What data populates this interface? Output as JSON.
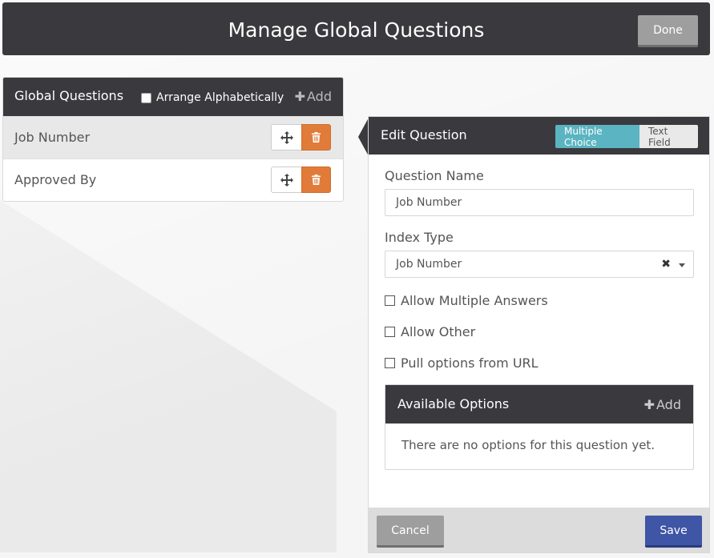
{
  "header": {
    "title": "Manage Global Questions",
    "done_label": "Done"
  },
  "global_questions": {
    "title": "Global Questions",
    "arrange_label": "Arrange Alphabetically",
    "arrange_checked": false,
    "add_label": "Add",
    "items": [
      {
        "label": "Job Number",
        "selected": true
      },
      {
        "label": "Approved By",
        "selected": false
      }
    ]
  },
  "edit_question": {
    "title": "Edit Question",
    "type_options": [
      "Multiple Choice",
      "Text Field"
    ],
    "type_selected": "Multiple Choice",
    "question_name_label": "Question Name",
    "question_name_value": "Job Number",
    "index_type_label": "Index Type",
    "index_type_value": "Job Number",
    "checkboxes": [
      {
        "label": "Allow Multiple Answers",
        "checked": false
      },
      {
        "label": "Allow Other",
        "checked": false
      },
      {
        "label": "Pull options from URL",
        "checked": false
      }
    ],
    "available_options": {
      "title": "Available Options",
      "add_label": "Add",
      "empty_text": "There are no options for this question yet."
    },
    "cancel_label": "Cancel",
    "save_label": "Save"
  },
  "colors": {
    "dark_header": "#3a3a3e",
    "delete_orange": "#e07b39",
    "segment_active": "#5bb4c1",
    "save_blue": "#3f55a6",
    "neutral_button": "#9e9e9e"
  }
}
